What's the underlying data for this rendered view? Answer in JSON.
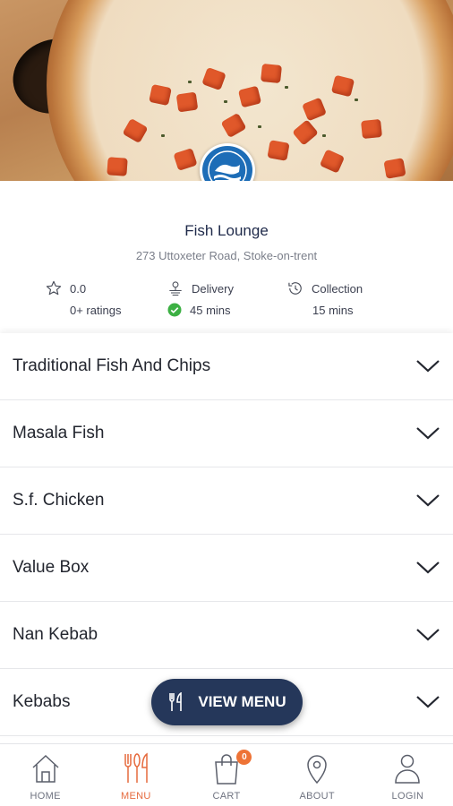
{
  "restaurant": {
    "name": "Fish Lounge",
    "address": "273 Uttoxeter Road, Stoke-on-trent"
  },
  "stats": {
    "rating": {
      "value": "0.0",
      "label": "0+ ratings"
    },
    "delivery": {
      "label": "Delivery",
      "time": "45 mins"
    },
    "collection": {
      "label": "Collection",
      "time": "15 mins"
    }
  },
  "categories": [
    {
      "label": "Traditional Fish And Chips"
    },
    {
      "label": "Masala Fish"
    },
    {
      "label": "S.f. Chicken"
    },
    {
      "label": "Value Box"
    },
    {
      "label": "Nan Kebab"
    },
    {
      "label": "Kebabs"
    }
  ],
  "view_menu_button": {
    "label": "VIEW MENU"
  },
  "nav": {
    "items": [
      {
        "label": "HOME",
        "icon": "home-icon"
      },
      {
        "label": "MENU",
        "icon": "cutlery-icon"
      },
      {
        "label": "CART",
        "icon": "shopping-bag-icon"
      },
      {
        "label": "ABOUT",
        "icon": "location-pin-icon"
      },
      {
        "label": "LOGIN",
        "icon": "user-icon"
      }
    ],
    "active": "MENU",
    "cart_count": "0"
  },
  "colors": {
    "accent": "#e66a3d",
    "button_bg": "#25375a",
    "success": "#3cb043",
    "title": "#1f2a4a"
  }
}
